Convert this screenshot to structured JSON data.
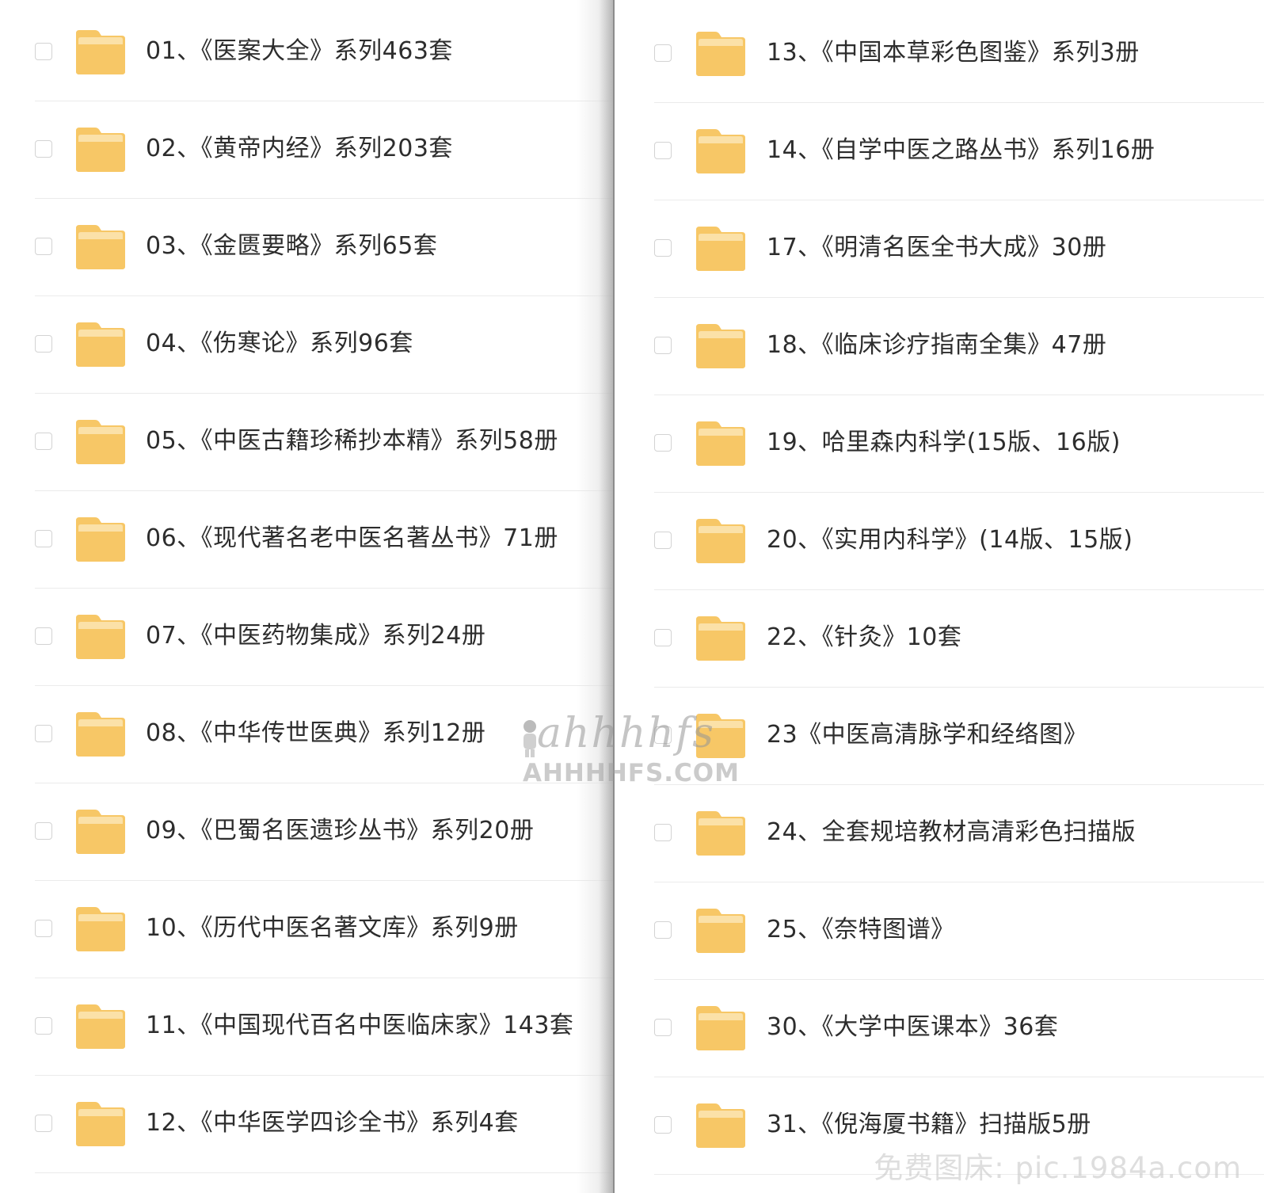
{
  "left_panel": {
    "items": [
      {
        "label": "01、《医案大全》系列463套"
      },
      {
        "label": "02、《黄帝内经》系列203套"
      },
      {
        "label": "03、《金匮要略》系列65套"
      },
      {
        "label": "04、《伤寒论》系列96套"
      },
      {
        "label": "05、《中医古籍珍稀抄本精》系列58册"
      },
      {
        "label": "06、《现代著名老中医名著丛书》71册"
      },
      {
        "label": "07、《中医药物集成》系列24册"
      },
      {
        "label": "08、《中华传世医典》系列12册"
      },
      {
        "label": "09、《巴蜀名医遗珍丛书》系列20册"
      },
      {
        "label": "10、《历代中医名著文库》系列9册"
      },
      {
        "label": "11、《中国现代百名中医临床家》143套"
      },
      {
        "label": "12、《中华医学四诊全书》系列4套"
      }
    ]
  },
  "right_panel": {
    "items": [
      {
        "label": "13、《中国本草彩色图鉴》系列3册"
      },
      {
        "label": "14、《自学中医之路丛书》系列16册"
      },
      {
        "label": "17、《明清名医全书大成》30册"
      },
      {
        "label": "18、《临床诊疗指南全集》47册"
      },
      {
        "label": "19、哈里森内科学(15版、16版)"
      },
      {
        "label": "20、《实用内科学》(14版、15版)"
      },
      {
        "label": "22、《针灸》10套"
      },
      {
        "label": "23《中医高清脉学和经络图》"
      },
      {
        "label": "24、全套规培教材高清彩色扫描版"
      },
      {
        "label": "25、《奈特图谱》"
      },
      {
        "label": "30、《大学中医课本》36套"
      },
      {
        "label": "31、《倪海厦书籍》扫描版5册"
      }
    ]
  },
  "watermark": {
    "script_text": "ahhhhfs",
    "domain_text": "AHHHHFS.COM"
  },
  "corner_watermark": "免费图床: pic.1984a.com",
  "colors": {
    "folder_body": "#f7c766",
    "folder_tab": "#fbe1a8",
    "checkbox_border": "#d3d3d3",
    "separator": "#ebebeb",
    "text": "#2d2d2d",
    "divider": "#8c8c8c"
  },
  "icons": {
    "item_icon": "folder-icon",
    "checkbox": "checkbox-unchecked"
  }
}
